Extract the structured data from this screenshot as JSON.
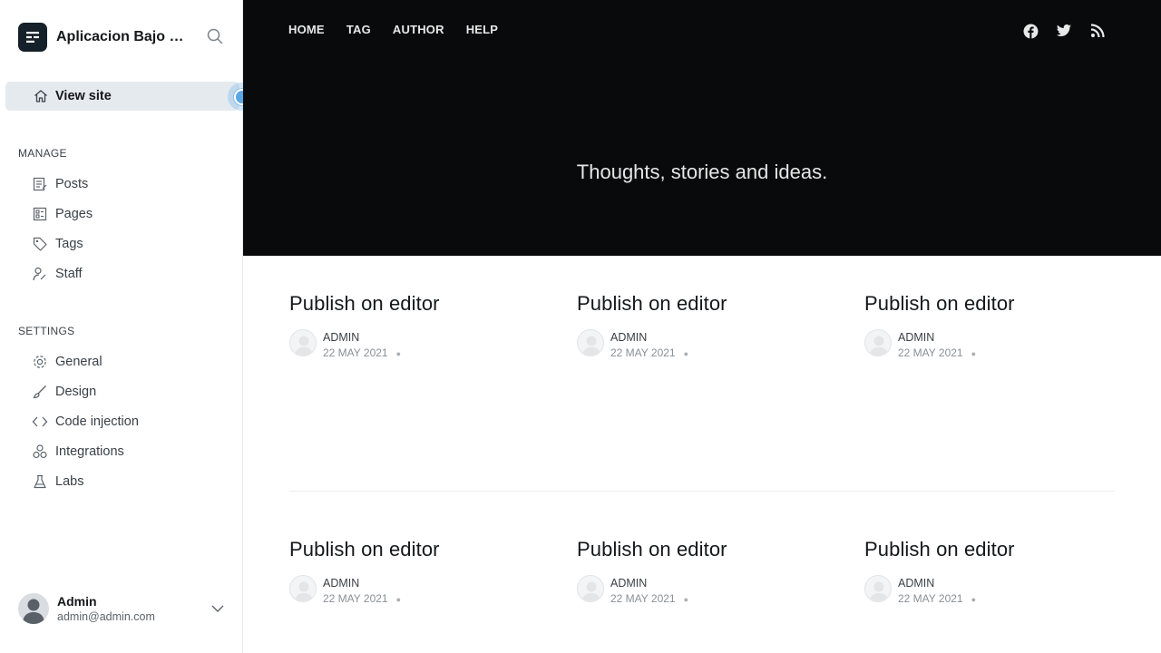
{
  "brand": {
    "title": "Aplicacion Bajo Pr..."
  },
  "sidebar": {
    "view_site": "View site",
    "manage_label": "MANAGE",
    "manage_items": [
      {
        "label": "Posts",
        "icon": "posts-icon"
      },
      {
        "label": "Pages",
        "icon": "pages-icon"
      },
      {
        "label": "Tags",
        "icon": "tag-icon"
      },
      {
        "label": "Staff",
        "icon": "staff-icon"
      }
    ],
    "settings_label": "SETTINGS",
    "settings_items": [
      {
        "label": "General",
        "icon": "gear-icon"
      },
      {
        "label": "Design",
        "icon": "brush-icon"
      },
      {
        "label": "Code injection",
        "icon": "code-icon"
      },
      {
        "label": "Integrations",
        "icon": "integrations-icon"
      },
      {
        "label": "Labs",
        "icon": "flask-icon"
      }
    ],
    "user": {
      "name": "Admin",
      "email": "admin@admin.com"
    }
  },
  "site": {
    "nav": [
      "HOME",
      "TAG",
      "AUTHOR",
      "HELP"
    ],
    "social": [
      "facebook-icon",
      "twitter-icon",
      "rss-icon"
    ],
    "tagline": "Thoughts, stories and ideas.",
    "posts": [
      {
        "title": "Publish on editor",
        "author": "ADMIN",
        "date": "22 MAY 2021"
      },
      {
        "title": "Publish on editor",
        "author": "ADMIN",
        "date": "22 MAY 2021"
      },
      {
        "title": "Publish on editor",
        "author": "ADMIN",
        "date": "22 MAY 2021"
      },
      {
        "title": "Publish on editor",
        "author": "ADMIN",
        "date": "22 MAY 2021"
      },
      {
        "title": "Publish on editor",
        "author": "ADMIN",
        "date": "22 MAY 2021"
      },
      {
        "title": "Publish on editor",
        "author": "ADMIN",
        "date": "22 MAY 2021"
      }
    ]
  },
  "colors": {
    "hero_bg": "#090a0b",
    "active_item_bg": "#e5eaef",
    "pulse": "#5aa6e6"
  }
}
